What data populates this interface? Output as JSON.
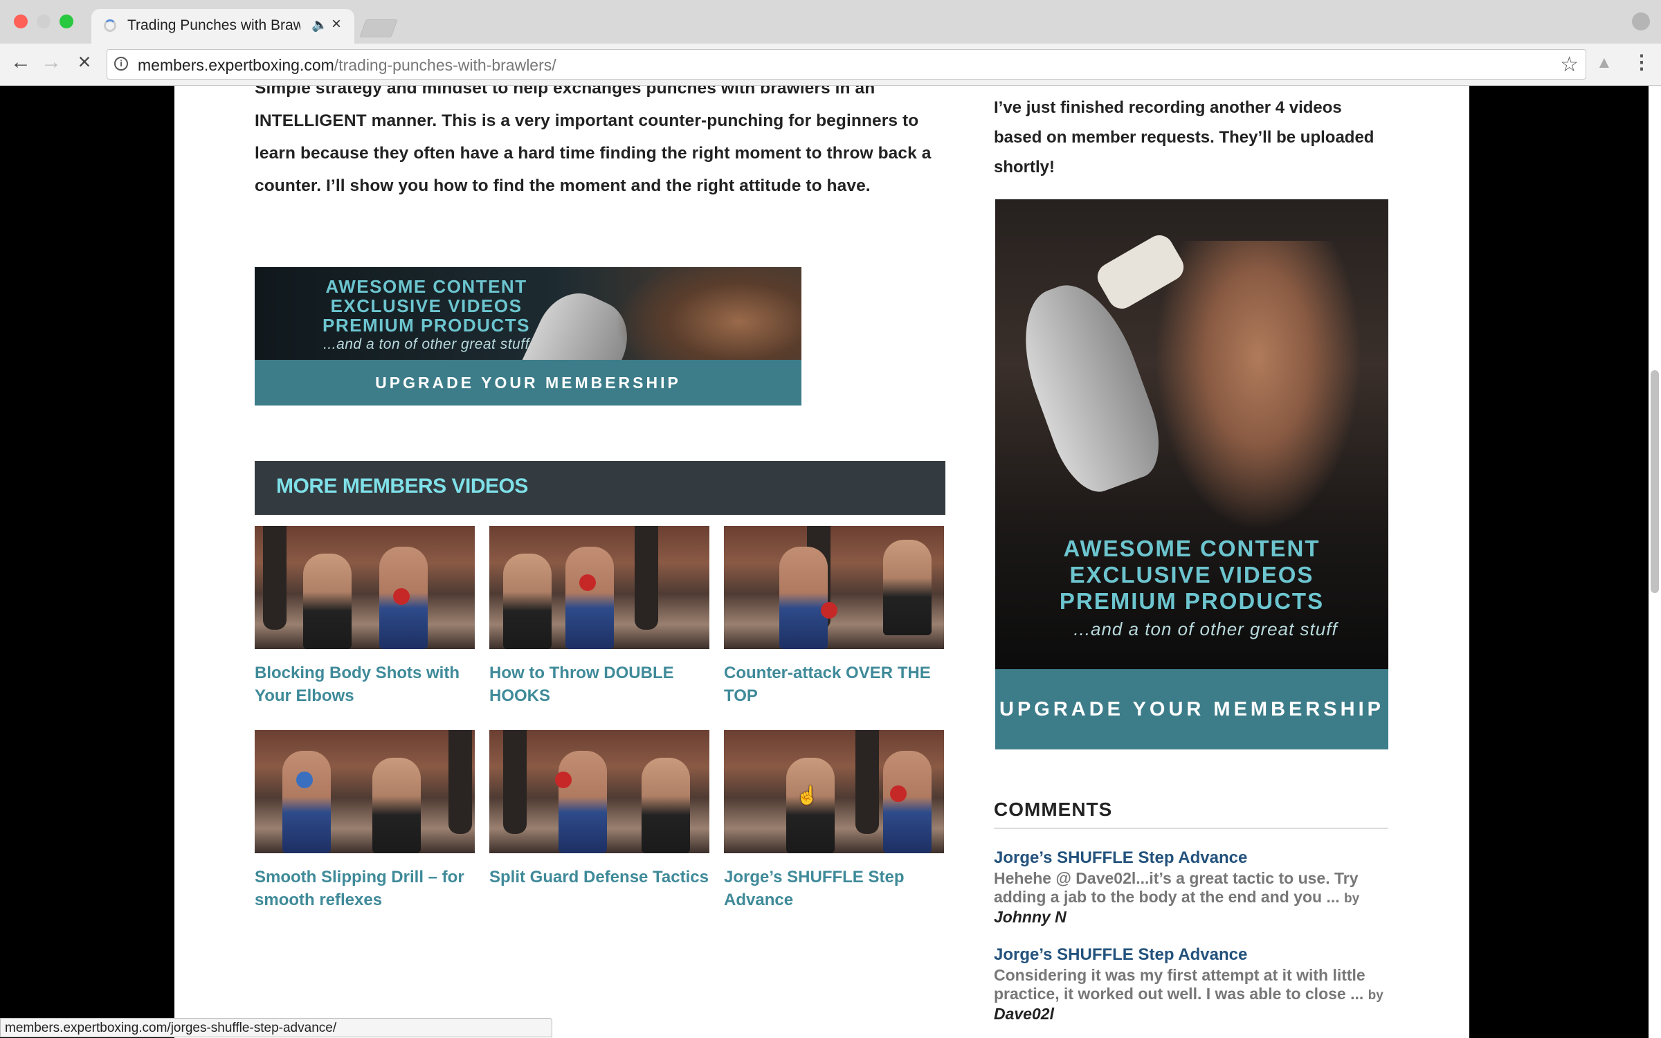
{
  "browser": {
    "tab_title": "Trading Punches with Brawl",
    "url_host": "members.expertboxing.com",
    "url_path": "/trading-punches-with-brawlers/",
    "status_url": "members.expertboxing.com/jorges-shuffle-step-advance/"
  },
  "content": {
    "intro": "Simple strategy and mindset to help exchanges punches with brawlers in an INTELLIGENT manner. This is a very important counter-punching for beginners to learn because they often have a hard time finding the right moment to throw back a counter. I’ll show you how to find the moment and the right attitude to have.",
    "banner": {
      "line1": "AWESOME CONTENT",
      "line2": "EXCLUSIVE VIDEOS",
      "line3": "PREMIUM PRODUCTS",
      "sub": "...and a ton of other great stuff",
      "cta": "UPGRADE YOUR MEMBERSHIP"
    },
    "more_header": "MORE MEMBERS VIDEOS",
    "videos": [
      {
        "title": "Blocking Body Shots with Your Elbows"
      },
      {
        "title": "How to Throw DOUBLE HOOKS"
      },
      {
        "title": "Counter-attack OVER THE TOP"
      },
      {
        "title": "Smooth Slipping Drill – for smooth reflexes"
      },
      {
        "title": "Split Guard Defense Tactics"
      },
      {
        "title": "Jorge’s SHUFFLE Step Advance"
      }
    ]
  },
  "sidebar": {
    "text": "I’ve just finished recording another 4 videos based on member requests. They’ll be uploaded shortly!",
    "ad": {
      "line1": "AWESOME CONTENT",
      "line2": "EXCLUSIVE VIDEOS",
      "line3": "PREMIUM PRODUCTS",
      "sub": "...and a ton of other great stuff",
      "cta": "UPGRADE YOUR MEMBERSHIP"
    },
    "comments_heading": "COMMENTS",
    "comments": [
      {
        "title": "Jorge’s SHUFFLE Step Advance",
        "body": "Hehehe @ Dave02l...it’s a great tactic to use. Try adding a jab to the body at the end and you ...",
        "by": "by",
        "author": "Johnny N"
      },
      {
        "title": "Jorge’s SHUFFLE Step Advance",
        "body": "Considering it was my first attempt at it with little practice, it worked out well. I was able to close ...",
        "by": "by",
        "author": "Dave02l"
      }
    ]
  },
  "colors": {
    "accent_teal": "#3d7d8a",
    "link": "#3f8a99",
    "header_text": "#7fe0e8"
  }
}
